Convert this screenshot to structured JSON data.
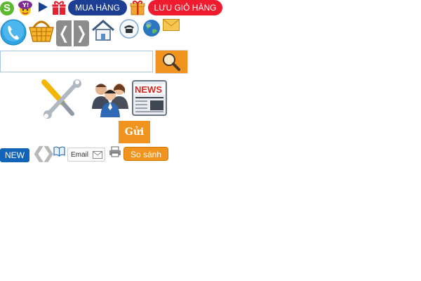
{
  "header": {
    "icons": [
      "skype-icon",
      "yahoo-icon",
      "play-icon",
      "gift-icon"
    ],
    "buy_label": "MUA HÀNG",
    "save_cart_label": "LƯU GIỎ HÀNG"
  },
  "toolbar": {
    "icons": [
      "phone-icon",
      "basket-icon",
      "prev-icon",
      "next-icon",
      "home-icon",
      "telephone-icon",
      "globe-icon",
      "mail-icon"
    ]
  },
  "search": {
    "value": "",
    "placeholder": "",
    "button_icon": "search-icon"
  },
  "categories": {
    "icons": [
      "tools-icon",
      "people-icon",
      "news-icon"
    ],
    "news_text": "NEWS"
  },
  "send": {
    "value": "",
    "button_label": "Gửi"
  },
  "footer": {
    "new_label": "NEW",
    "email_label": "Email",
    "compare_label": "So sánh"
  },
  "colors": {
    "accent_orange": "#f0931f",
    "brand_blue": "#1d3f93",
    "alert_red": "#ee1c2e",
    "new_blue": "#1164b8"
  }
}
